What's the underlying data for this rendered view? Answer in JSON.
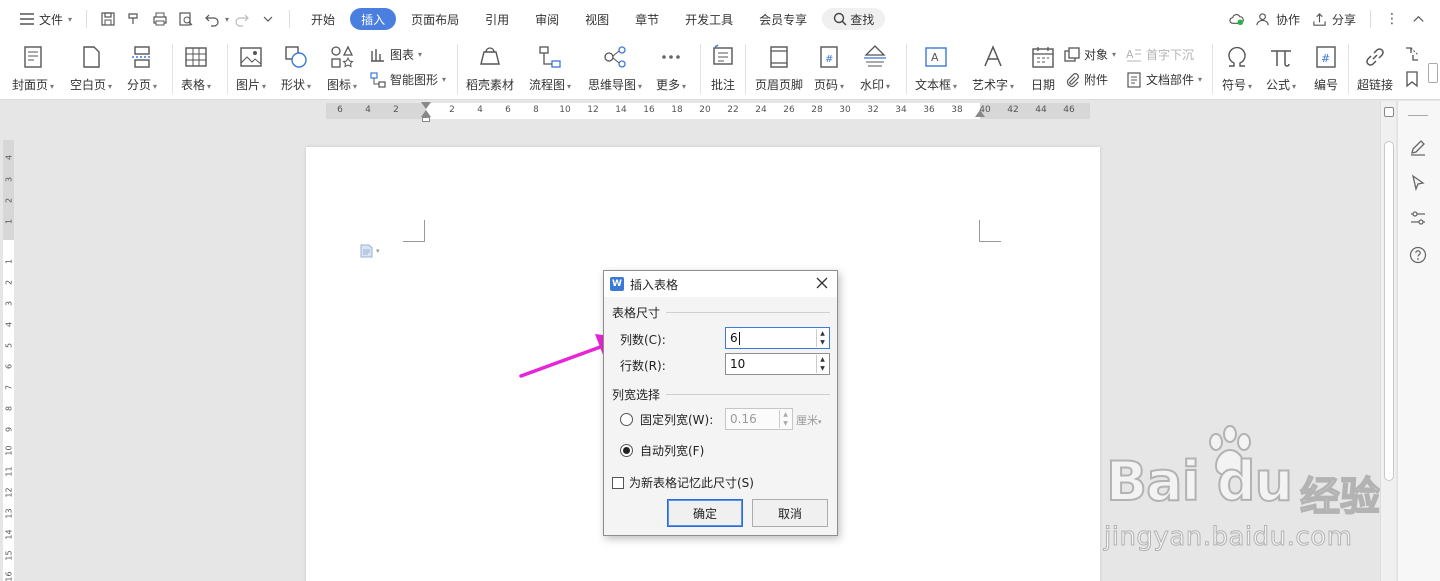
{
  "menubar": {
    "file_label": "文件",
    "tabs": [
      {
        "label": "开始",
        "active": false
      },
      {
        "label": "插入",
        "active": true
      },
      {
        "label": "页面布局",
        "active": false
      },
      {
        "label": "引用",
        "active": false
      },
      {
        "label": "审阅",
        "active": false
      },
      {
        "label": "视图",
        "active": false
      },
      {
        "label": "章节",
        "active": false
      },
      {
        "label": "开发工具",
        "active": false
      },
      {
        "label": "会员专享",
        "active": false
      }
    ],
    "search_label": "查找",
    "collab_label": "协作",
    "share_label": "分享"
  },
  "ribbon": {
    "cover_page": "封面页",
    "blank_page": "空白页",
    "page_break": "分页",
    "table": "表格",
    "picture": "图片",
    "shape": "形状",
    "icon": "图标",
    "chart": "图表",
    "smart_art": "智能图形",
    "material": "稻壳素材",
    "flowchart": "流程图",
    "mindmap": "思维导图",
    "more": "更多",
    "comment": "批注",
    "header_footer": "页眉页脚",
    "page_number": "页码",
    "watermark": "水印",
    "textbox": "文本框",
    "wordart": "艺术字",
    "date": "日期",
    "object": "对象",
    "attachment": "附件",
    "drop_cap": "首字下沉",
    "doc_parts": "文档部件",
    "symbol": "符号",
    "formula": "公式",
    "numbering": "编号",
    "hyperlink": "超链接"
  },
  "ruler": {
    "left_numbers": [
      "6",
      "4",
      "2"
    ],
    "right_numbers": [
      "2",
      "4",
      "6",
      "8",
      "10",
      "12",
      "14",
      "16",
      "18",
      "20",
      "22",
      "24",
      "26",
      "28",
      "30",
      "32",
      "34",
      "36",
      "38",
      "40",
      "42",
      "44",
      "46"
    ],
    "vertical_numbers": [
      "4",
      "3",
      "2",
      "1",
      "1",
      "2",
      "3",
      "4",
      "5",
      "6",
      "7",
      "8",
      "9",
      "10",
      "11",
      "12",
      "13",
      "14",
      "15",
      "16"
    ]
  },
  "dialog": {
    "title": "插入表格",
    "size_group": "表格尺寸",
    "columns_label": "列数(C):",
    "columns_value": "6",
    "rows_label": "行数(R):",
    "rows_value": "10",
    "width_group": "列宽选择",
    "fixed_width_label": "固定列宽(W):",
    "fixed_width_value": "0.16",
    "unit_label": "厘米",
    "auto_width_label": "自动列宽(F)",
    "remember_label": "为新表格记忆此尺寸(S)",
    "ok_label": "确定",
    "cancel_label": "取消"
  },
  "watermark": {
    "brand": "Bai du",
    "cn": "经验",
    "url": "jingyan.baidu.com"
  },
  "colors": {
    "accent": "#4a7fe0",
    "arrow": "#e825d6"
  }
}
